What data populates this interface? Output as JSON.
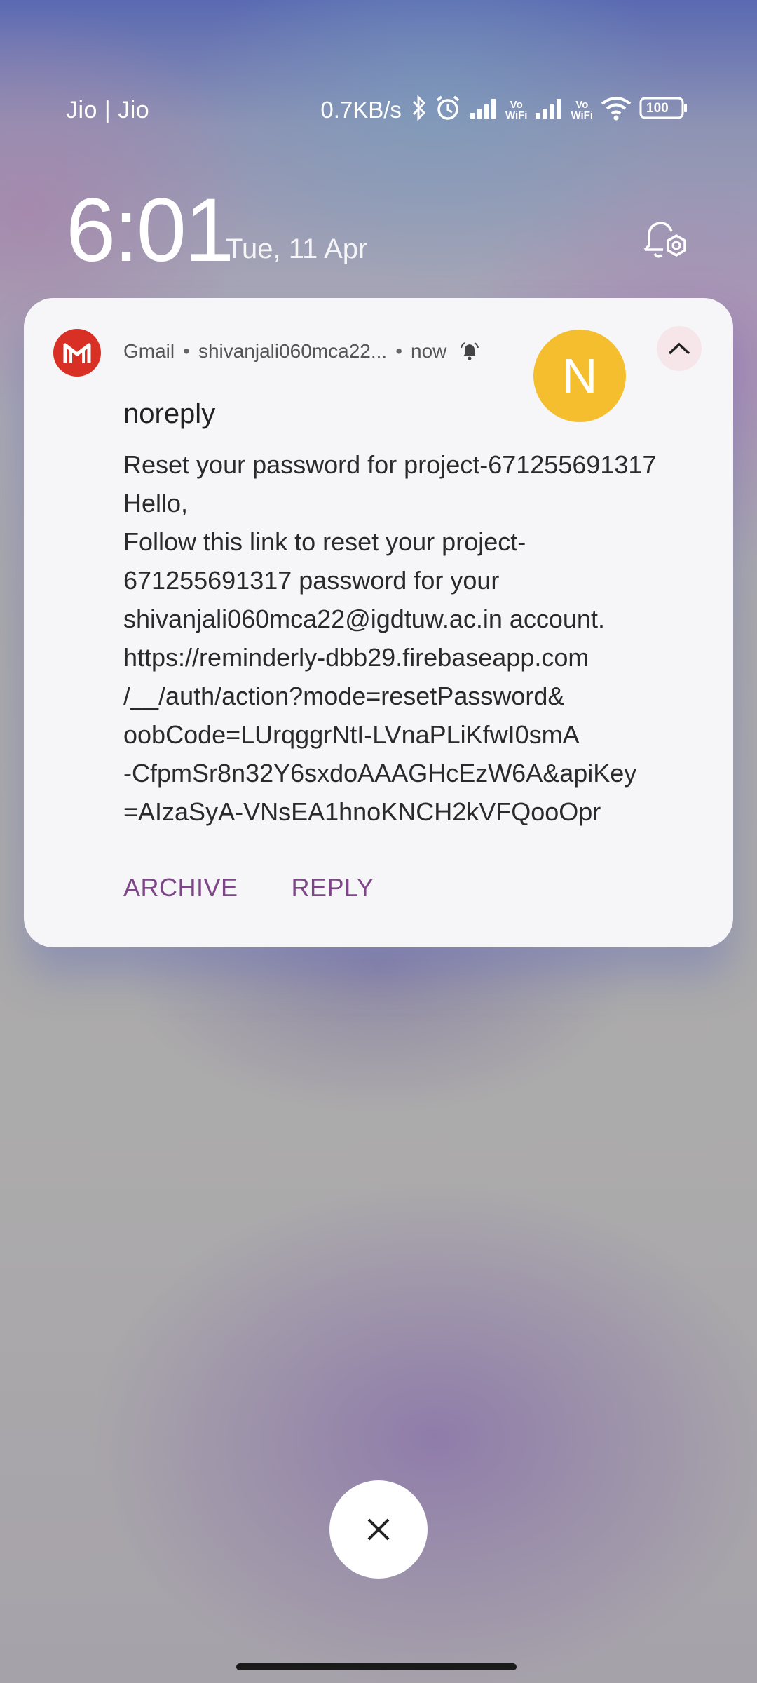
{
  "status_bar": {
    "carrier": "Jio | Jio",
    "net_speed": "0.7KB/s",
    "vowifi_label_top": "Vo",
    "vowifi_label_bottom": "WiFi",
    "battery": "100",
    "icons": [
      "bluetooth-icon",
      "alarm-icon",
      "signal-icon",
      "vowifi-icon",
      "signal-icon",
      "vowifi-icon",
      "wifi-icon",
      "battery-icon"
    ]
  },
  "lock_screen": {
    "time": "6:01",
    "date": "Tue, 11 Apr"
  },
  "notification": {
    "app_name": "Gmail",
    "separator": "•",
    "account": "shivanjali060mca22...",
    "time": "now",
    "avatar_letter": "N",
    "sender": "noreply",
    "body_lines": [
      "Reset your password for project-671255691317",
      "Hello,",
      "Follow this link to reset your project-",
      "671255691317 password for your",
      "shivanjali060mca22@igdtuw.ac.in account.",
      "https://reminderly-dbb29.firebaseapp.com",
      "/__/auth/action?mode=resetPassword&",
      "oobCode=LUrqggrNtI-LVnaPLiKfwI0smA",
      "-CfpmSr8n32Y6sxdoAAAGHcEzW6A&apiKey",
      "=AIzaSyA-VNsEA1hnoKNCH2kVFQooOpr"
    ],
    "actions": {
      "archive": "ARCHIVE",
      "reply": "REPLY"
    },
    "colors": {
      "accent": "#7e4688",
      "gmail_red": "#d93025",
      "avatar": "#f4be2f"
    }
  }
}
